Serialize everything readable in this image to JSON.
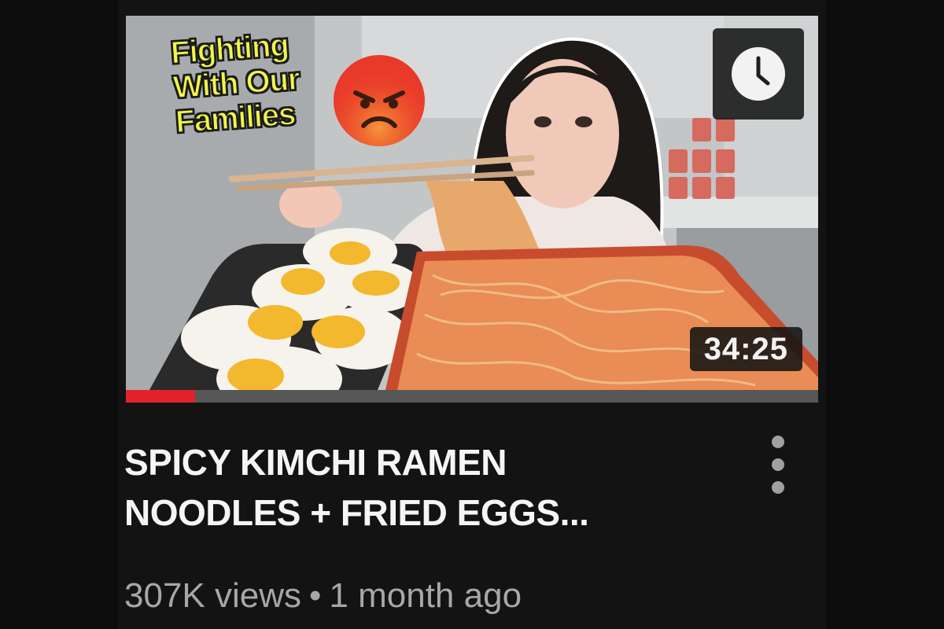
{
  "video": {
    "title": "SPICY KIMCHI RAMEN NOODLES + FRIED EGGS...",
    "views": "307K views",
    "separator": "•",
    "age": "1 month ago",
    "duration": "34:25",
    "thumbnail_caption": "Fighting With Our Families",
    "watch_progress_fraction": 0.1
  },
  "icons": {
    "watch_later": "clock-icon",
    "angry_emoji": "angry-face-icon",
    "more": "more-vertical-icon"
  },
  "colors": {
    "background": "#0c0c0c",
    "progress_fill": "#e3232b",
    "caption_text": "#f1f54a",
    "title_text": "#f5f5f5",
    "meta_text": "#a7a7a7"
  }
}
